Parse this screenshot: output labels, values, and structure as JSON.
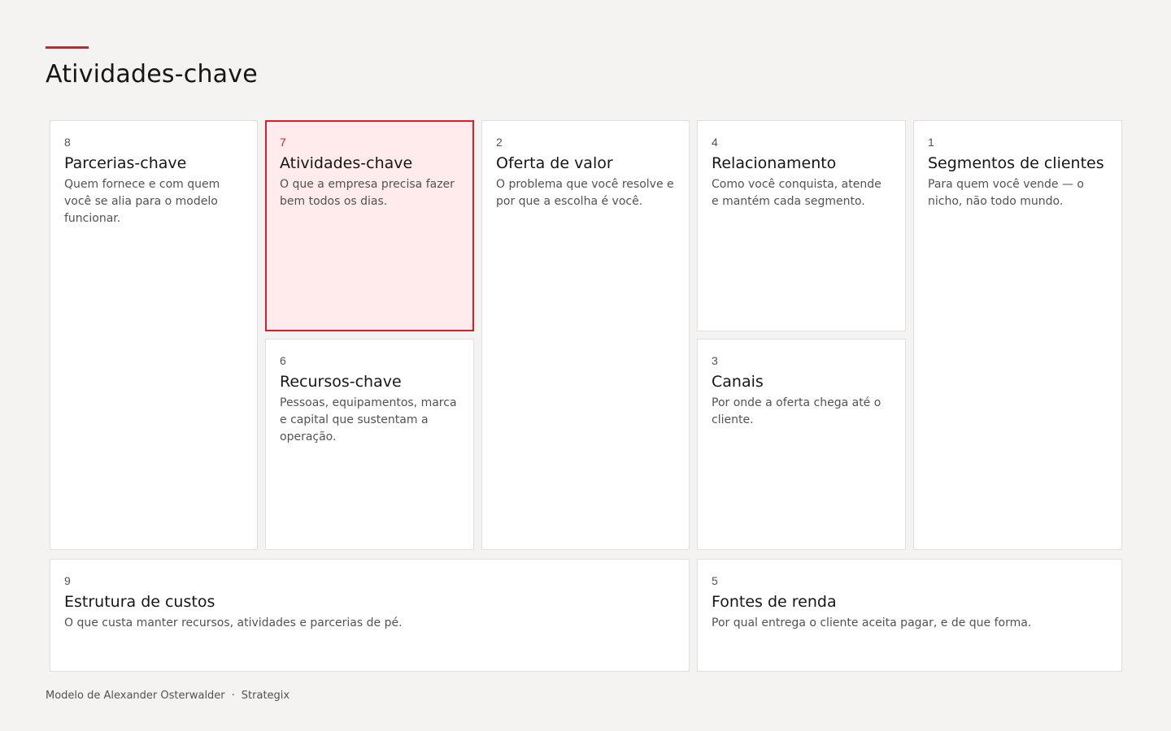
{
  "header": {
    "title": "Atividades-chave"
  },
  "blocks": {
    "parcerias": {
      "number": "8",
      "title": "Parcerias-chave",
      "description": "Quem fornece e com quem você se alia para o modelo funcionar."
    },
    "atividades": {
      "number": "7",
      "title": "Atividades-chave",
      "description": "O que a empresa precisa fazer bem todos os dias."
    },
    "recursos": {
      "number": "6",
      "title": "Recursos-chave",
      "description": "Pessoas, equipamentos, marca e capital que sustentam a operação."
    },
    "oferta": {
      "number": "2",
      "title": "Oferta de valor",
      "description": "O problema que você resolve e por que a escolha é você."
    },
    "relacionamento": {
      "number": "4",
      "title": "Relacionamento",
      "description": "Como você conquista, atende e mantém cada segmento."
    },
    "canais": {
      "number": "3",
      "title": "Canais",
      "description": "Por onde a oferta chega até o cliente."
    },
    "segmentos": {
      "number": "1",
      "title": "Segmentos de clientes",
      "description": "Para quem você vende — o nicho, não todo mundo."
    },
    "custos": {
      "number": "9",
      "title": "Estrutura de custos",
      "description": "O que custa manter recursos, atividades e parcerias de pé."
    },
    "renda": {
      "number": "5",
      "title": "Fontes de renda",
      "description": "Por qual entrega o cliente aceita pagar, e de que forma."
    }
  },
  "selected_block": "atividades",
  "footer": {
    "credit": "Modelo de Alexander Osterwalder",
    "separator": "·",
    "brand": "Strategix"
  },
  "colors": {
    "accent": "#da1e28",
    "active_background": "#ffebeb",
    "page_background": "#f4f3f1"
  }
}
